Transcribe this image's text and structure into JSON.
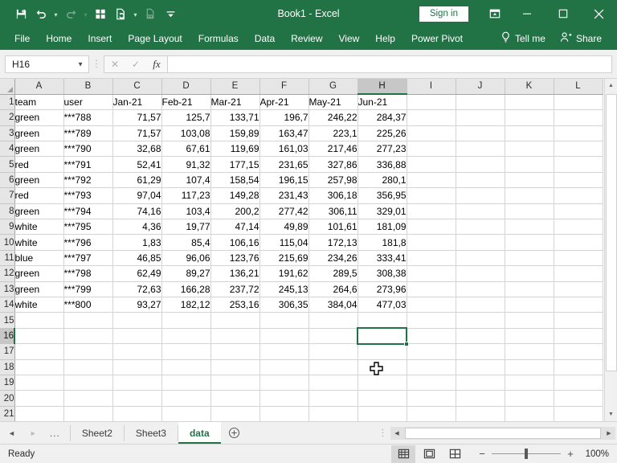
{
  "window": {
    "title": "Book1  -  Excel",
    "signin_label": "Sign in",
    "minimize": "─",
    "maximize": "□",
    "close": "✕"
  },
  "quick_access": {
    "items": [
      {
        "name": "save-icon",
        "caret": false,
        "dim": false
      },
      {
        "name": "undo-icon",
        "caret": true,
        "dim": false
      },
      {
        "name": "redo-icon",
        "caret": true,
        "dim": true
      },
      {
        "name": "grid-icon",
        "caret": false,
        "dim": false
      },
      {
        "name": "refresh-document-icon",
        "caret": true,
        "dim": false
      },
      {
        "name": "document-link-icon",
        "caret": false,
        "dim": true
      },
      {
        "name": "customize-toolbar-icon",
        "caret": false,
        "dim": false
      }
    ]
  },
  "ribbon": {
    "tabs": [
      {
        "label": "File"
      },
      {
        "label": "Home"
      },
      {
        "label": "Insert"
      },
      {
        "label": "Page Layout"
      },
      {
        "label": "Formulas"
      },
      {
        "label": "Data"
      },
      {
        "label": "Review"
      },
      {
        "label": "View"
      },
      {
        "label": "Help"
      },
      {
        "label": "Power Pivot"
      }
    ],
    "tell_me": "Tell me",
    "share": "Share"
  },
  "formula_bar": {
    "name_box": "H16",
    "cancel_icon": "✕",
    "enter_icon": "✓",
    "function_icon": "fx",
    "value": ""
  },
  "grid": {
    "columns": [
      "A",
      "B",
      "C",
      "D",
      "E",
      "F",
      "G",
      "H",
      "I",
      "J",
      "K",
      "L"
    ],
    "selected_column": "H",
    "selected_row": 16,
    "selected_cell": "H16",
    "rows": [
      1,
      2,
      3,
      4,
      5,
      6,
      7,
      8,
      9,
      10,
      11,
      12,
      13,
      14,
      15,
      16,
      17,
      18,
      19,
      20,
      21
    ],
    "headers": [
      "team",
      "user",
      "Jan-21",
      "Feb-21",
      "Mar-21",
      "Apr-21",
      "May-21",
      "Jun-21"
    ],
    "data": [
      [
        "green",
        "***788",
        "71,57",
        "125,7",
        "133,71",
        "196,7",
        "246,22",
        "284,37"
      ],
      [
        "green",
        "***789",
        "71,57",
        "103,08",
        "159,89",
        "163,47",
        "223,1",
        "225,26"
      ],
      [
        "green",
        "***790",
        "32,68",
        "67,61",
        "119,69",
        "161,03",
        "217,46",
        "277,23"
      ],
      [
        "red",
        "***791",
        "52,41",
        "91,32",
        "177,15",
        "231,65",
        "327,86",
        "336,88"
      ],
      [
        "green",
        "***792",
        "61,29",
        "107,4",
        "158,54",
        "196,15",
        "257,98",
        "280,1"
      ],
      [
        "red",
        "***793",
        "97,04",
        "117,23",
        "149,28",
        "231,43",
        "306,18",
        "356,95"
      ],
      [
        "green",
        "***794",
        "74,16",
        "103,4",
        "200,2",
        "277,42",
        "306,11",
        "329,01"
      ],
      [
        "white",
        "***795",
        "4,36",
        "19,77",
        "47,14",
        "49,89",
        "101,61",
        "181,09"
      ],
      [
        "white",
        "***796",
        "1,83",
        "85,4",
        "106,16",
        "115,04",
        "172,13",
        "181,8"
      ],
      [
        "blue",
        "***797",
        "46,85",
        "96,06",
        "123,76",
        "215,69",
        "234,26",
        "333,41"
      ],
      [
        "green",
        "***798",
        "62,49",
        "89,27",
        "136,21",
        "191,62",
        "289,5",
        "308,38"
      ],
      [
        "green",
        "***799",
        "72,63",
        "166,28",
        "237,72",
        "245,13",
        "264,6",
        "273,96"
      ],
      [
        "white",
        "***800",
        "93,27",
        "182,12",
        "253,16",
        "306,35",
        "384,04",
        "477,03"
      ]
    ]
  },
  "sheet_tabs": {
    "first_arrow": "◄",
    "last_arrow": "►",
    "ellipsis": "...",
    "tabs": [
      {
        "label": "Sheet2",
        "active": false
      },
      {
        "label": "Sheet3",
        "active": false
      },
      {
        "label": "data",
        "active": true
      }
    ],
    "add_sheet": "+"
  },
  "status_bar": {
    "mode": "Ready",
    "views": [
      {
        "name": "normal-view-button",
        "active": true
      },
      {
        "name": "page-layout-view-button",
        "active": false
      },
      {
        "name": "page-break-preview-button",
        "active": false
      }
    ],
    "zoom_out": "−",
    "zoom_in": "+",
    "zoom_level": "100%"
  },
  "colors": {
    "brand_green": "#217346",
    "selection_green": "#217346",
    "header_gray": "#e6e6e6"
  }
}
